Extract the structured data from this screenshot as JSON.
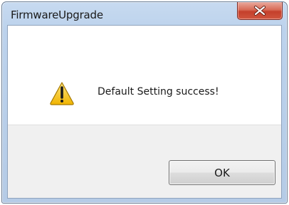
{
  "window": {
    "title": "FirmwareUpgrade"
  },
  "titlebar": {
    "close_icon": "close-icon"
  },
  "dialog": {
    "icon": "warning-icon",
    "message": "Default Setting success!",
    "ok_label": "OK"
  },
  "colors": {
    "warning_yellow": "#f6c61a",
    "close_red": "#c4402b",
    "titlebar_blue": "#bcd2ec"
  }
}
